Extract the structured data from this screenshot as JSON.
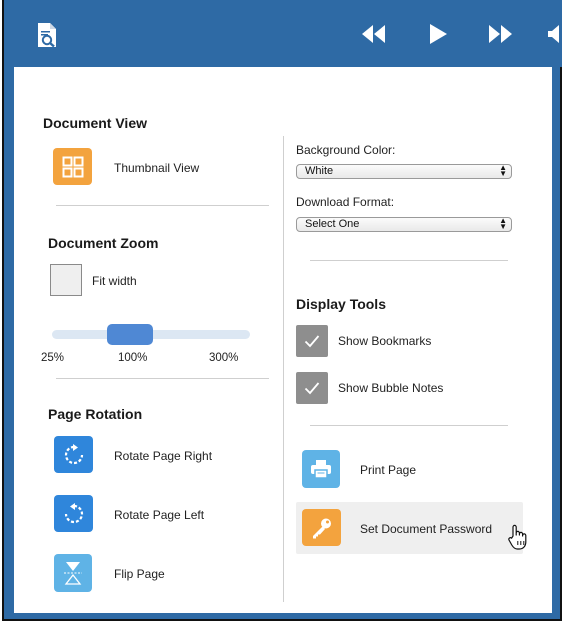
{
  "colors": {
    "accent_blue": "#2e6aa5",
    "tile_orange": "#f3a33e",
    "tile_blue": "#2f86db",
    "tile_light_blue": "#5fb3e6",
    "check_grey": "#8e8e8e"
  },
  "toolbar": {
    "app_icon": "document-search-icon",
    "buttons": [
      "rewind-icon",
      "play-icon",
      "fast-forward-icon",
      "volume-icon"
    ]
  },
  "document_view": {
    "heading": "Document View",
    "thumbnail_label": "Thumbnail View"
  },
  "document_zoom": {
    "heading": "Document Zoom",
    "fit_width_label": "Fit width",
    "fit_width_checked": false,
    "slider_value_percent": 100,
    "ticks": [
      "25%",
      "100%",
      "300%"
    ]
  },
  "page_rotation": {
    "heading": "Page Rotation",
    "rotate_right": "Rotate Page Right",
    "rotate_left": "Rotate Page Left",
    "flip": "Flip Page"
  },
  "settings": {
    "background_color_label": "Background Color:",
    "background_color_value": "White",
    "download_format_label": "Download Format:",
    "download_format_value": "Select One"
  },
  "display_tools": {
    "heading": "Display Tools",
    "show_bookmarks": "Show Bookmarks",
    "show_bookmarks_checked": true,
    "show_bubble_notes": "Show Bubble Notes",
    "show_bubble_notes_checked": true
  },
  "actions": {
    "print_page": "Print Page",
    "set_password": "Set Document Password"
  }
}
